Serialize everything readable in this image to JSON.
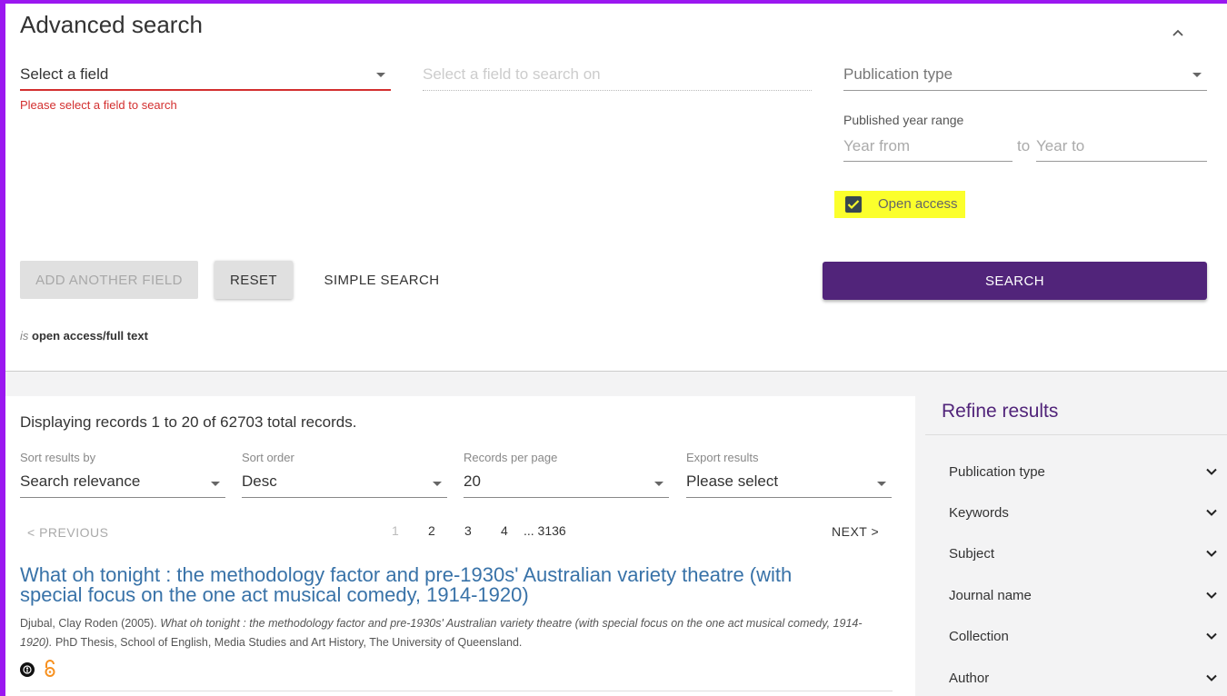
{
  "advanced_search": {
    "title": "Advanced search",
    "field_select": {
      "value": "Select a field",
      "error": "Please select a field to search"
    },
    "search_on_placeholder": "Select a field to search on",
    "publication_type_placeholder": "Publication type",
    "year_range": {
      "label": "Published year range",
      "from_placeholder": "Year from",
      "to_label": "to",
      "to_placeholder": "Year to"
    },
    "open_access": {
      "label": "Open access",
      "checked": true
    },
    "buttons": {
      "add_field": "ADD ANOTHER FIELD",
      "reset": "RESET",
      "simple_search": "SIMPLE SEARCH",
      "search": "SEARCH"
    },
    "query_summary": {
      "prefix": "is",
      "value": "open access/full text"
    }
  },
  "results": {
    "displaying": "Displaying records 1 to 20 of 62703 total records.",
    "sort_by": {
      "label": "Sort results by",
      "value": "Search relevance"
    },
    "sort_order": {
      "label": "Sort order",
      "value": "Desc"
    },
    "per_page": {
      "label": "Records per page",
      "value": "20"
    },
    "export": {
      "label": "Export results",
      "value": "Please select"
    },
    "pager": {
      "prev": "< PREVIOUS",
      "pages": [
        "1",
        "2",
        "3",
        "4",
        "... 3136"
      ],
      "current": "1",
      "next": "NEXT >"
    },
    "items": [
      {
        "title": "What oh tonight : the methodology factor and pre-1930s' Australian variety theatre (with special focus on the one act musical comedy, 1914-1920)",
        "authors_year": "Djubal, Clay Roden (2005).",
        "italic_title": "What oh tonight : the methodology factor and pre-1930s' Australian variety theatre (with special focus on the one act musical comedy, 1914-1920).",
        "rest": "PhD Thesis, School of English, Media Studies and Art History, The University of Queensland."
      }
    ]
  },
  "refine": {
    "title": "Refine results",
    "facets": [
      "Publication type",
      "Keywords",
      "Subject",
      "Journal name",
      "Collection",
      "Author"
    ]
  },
  "colors": {
    "brand": "#51247a",
    "link": "#3872a8",
    "error": "#d32f2f",
    "highlight": "#fbff2c",
    "open_access": "#f7901e",
    "frame": "#9b17f0"
  },
  "icons": [
    "chevron-up-icon",
    "dropdown-caret-icon",
    "checkbox-checked-icon",
    "creative-commons-icon",
    "open-access-lock-icon",
    "chevron-down-icon"
  ]
}
